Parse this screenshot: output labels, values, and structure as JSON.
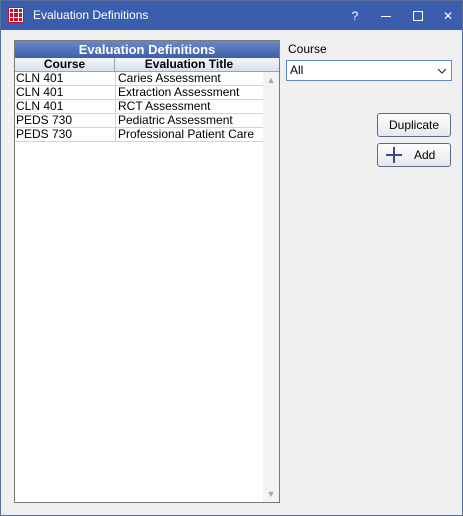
{
  "window": {
    "title": "Evaluation Definitions",
    "help_label": "?",
    "close_label": "✕"
  },
  "grid": {
    "title": "Evaluation Definitions",
    "columns": [
      "Course",
      "Evaluation Title"
    ],
    "rows": [
      {
        "course": "CLN 401",
        "title": "Caries Assessment"
      },
      {
        "course": "CLN 401",
        "title": "Extraction Assessment"
      },
      {
        "course": "CLN 401",
        "title": "RCT Assessment"
      },
      {
        "course": "PEDS 730",
        "title": "Pediatric Assessment"
      },
      {
        "course": "PEDS 730",
        "title": "Professional Patient Care"
      }
    ]
  },
  "filter": {
    "label": "Course",
    "selected": "All"
  },
  "buttons": {
    "duplicate": "Duplicate",
    "add": "Add"
  },
  "icons": {
    "app": "app-grid-icon",
    "help": "help-icon",
    "minimize": "minimize-icon",
    "maximize": "maximize-icon",
    "close": "close-icon",
    "dropdown": "chevron-down-icon",
    "add": "plus-icon",
    "scroll_up": "scroll-up-icon",
    "scroll_down": "scroll-down-icon"
  },
  "colors": {
    "titlebar": "#3b5dae",
    "grid_header": "#3e5ea8",
    "accent_border": "#5a8bc8"
  }
}
